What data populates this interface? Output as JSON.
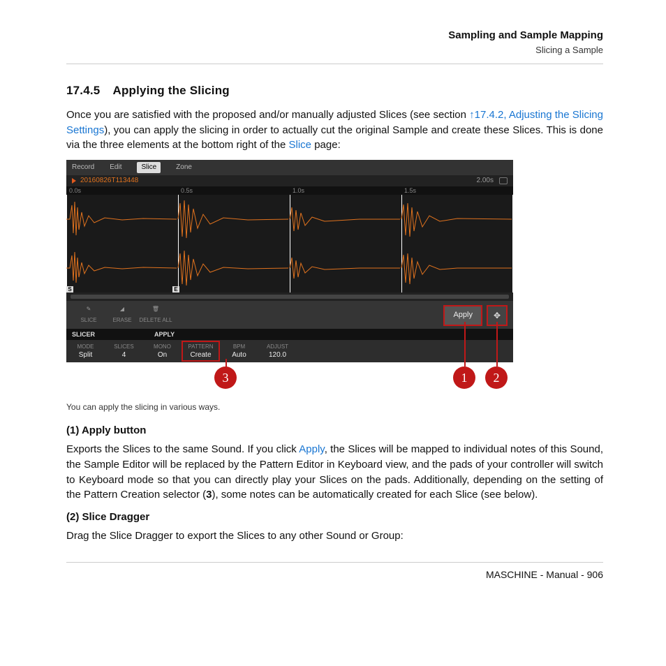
{
  "header": {
    "title": "Sampling and Sample Mapping",
    "subtitle": "Slicing a Sample"
  },
  "section": {
    "number": "17.4.5",
    "title": "Applying the Slicing"
  },
  "intro": {
    "pre": "Once you are satisfied with the proposed and/or manually adjusted Slices (see section ",
    "link1": "↑17.4.2, Adjusting the Slicing Settings",
    "mid": "), you can apply the slicing in order to actually cut the original Sample and create these Slices. This is done via the three elements at the bottom right of the ",
    "link2": "Slice",
    "post": " page:"
  },
  "tabs": {
    "record": "Record",
    "edit": "Edit",
    "slice": "Slice",
    "zone": "Zone"
  },
  "sample": {
    "name": "20160826T113448",
    "length": "2.00s"
  },
  "timeline": {
    "t0": "0.0s",
    "t1": "0.5s",
    "t2": "1.0s",
    "t3": "1.5s"
  },
  "marks": {
    "s": "S",
    "e": "E"
  },
  "tools": {
    "slice": "SLICE",
    "erase": "ERASE",
    "deleteall": "DELETE ALL"
  },
  "apply_btn": "Apply",
  "panels": {
    "slicer": "SLICER",
    "apply": "APPLY"
  },
  "params": {
    "mode": {
      "lab": "MODE",
      "val": "Split"
    },
    "slices": {
      "lab": "SLICES",
      "val": "4"
    },
    "mono": {
      "lab": "MONO",
      "val": "On"
    },
    "pattern": {
      "lab": "PATTERN",
      "val": "Create"
    },
    "bpm": {
      "lab": "BPM",
      "val": "Auto"
    },
    "adjust": {
      "lab": "ADJUST",
      "val": "120.0"
    }
  },
  "callouts": {
    "c1": "1",
    "c2": "2",
    "c3": "3"
  },
  "caption": "You can apply the slicing in various ways.",
  "h1": "(1) Apply button",
  "p1": {
    "pre": "Exports the Slices to the same Sound. If you click ",
    "link": "Apply",
    "post": ", the Slices will be mapped to individual notes of this Sound, the Sample Editor will be replaced by the Pattern Editor in Keyboard view, and the pads of your controller will switch to Keyboard mode so that you can directly play your Slices on the pads. Additionally, depending on the setting of the Pattern Creation selector (",
    "bold": "3",
    "tail": "), some notes can be automatically created for each Slice (see below)."
  },
  "h2": "(2) Slice Dragger",
  "p2": "Drag the Slice Dragger to export the Slices to any other Sound or Group:",
  "footer": "MASCHINE - Manual - 906"
}
